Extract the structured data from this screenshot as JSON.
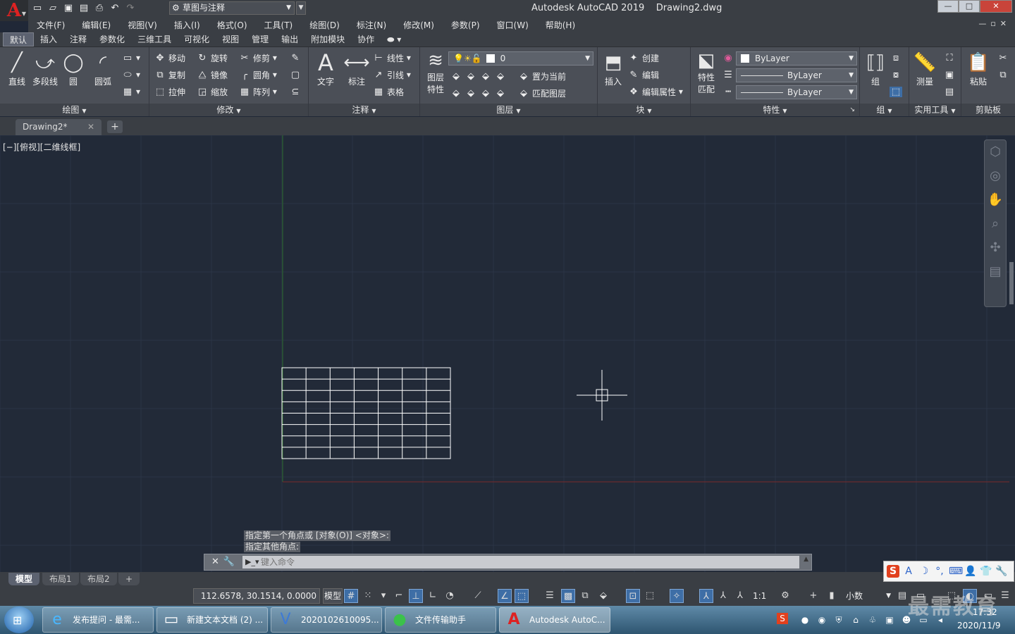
{
  "window": {
    "app_title": "Autodesk AutoCAD 2019",
    "doc_title": "Drawing2.dwg",
    "workspace": "草图与注释",
    "minimize": "—",
    "maximize": "□",
    "close": "✕"
  },
  "menu": [
    "文件(F)",
    "编辑(E)",
    "视图(V)",
    "插入(I)",
    "格式(O)",
    "工具(T)",
    "绘图(D)",
    "标注(N)",
    "修改(M)",
    "参数(P)",
    "窗口(W)",
    "帮助(H)"
  ],
  "ribbon_tabs": [
    "默认",
    "插入",
    "注释",
    "参数化",
    "三维工具",
    "可视化",
    "视图",
    "管理",
    "输出",
    "附加模块",
    "协作"
  ],
  "ribbon": {
    "draw": {
      "title": "绘图",
      "line": "直线",
      "polyline": "多段线",
      "circle": "圆",
      "arc": "圆弧"
    },
    "modify": {
      "title": "修改",
      "move": "移动",
      "rotate": "旋转",
      "trim": "修剪",
      "copy": "复制",
      "mirror": "镜像",
      "fillet": "圆角",
      "stretch": "拉伸",
      "scale": "缩放",
      "array": "阵列"
    },
    "annotation": {
      "title": "注释",
      "text": "文字",
      "dimension": "标注",
      "linear": "线性",
      "leader": "引线",
      "table": "表格"
    },
    "layers": {
      "title": "图层",
      "layer_props_1": "图层",
      "layer_props_2": "特性",
      "layer_value": "0",
      "set_current": "置为当前",
      "match_layer": "匹配图层"
    },
    "block": {
      "title": "块",
      "insert": "插入",
      "create": "创建",
      "edit": "编辑",
      "edit_attr": "编辑属性"
    },
    "properties": {
      "title": "特性",
      "match_1": "特性",
      "match_2": "匹配",
      "color": "ByLayer",
      "linetype": "ByLayer",
      "lineweight": "ByLayer"
    },
    "groups": {
      "title": "组",
      "group": "组"
    },
    "utilities": {
      "title": "实用工具",
      "measure": "测量"
    },
    "clipboard": {
      "title": "剪贴板",
      "paste": "粘贴"
    }
  },
  "file_tab": {
    "name": "Drawing2*",
    "close": "✕",
    "new": "+"
  },
  "viewport_label": "[−][俯视][二维线框]",
  "command": {
    "history_1": "指定第一个角点或 [对象(O)] <对象>:",
    "history_2": "指定其他角点:",
    "placeholder": "键入命令"
  },
  "layout_tabs": [
    "模型",
    "布局1",
    "布局2"
  ],
  "status": {
    "coords": "112.6578, 30.1514, 0.0000",
    "model": "模型",
    "scale": "1:1",
    "units": "小数"
  },
  "taskbar": {
    "tasks": [
      "发布提问 - 最需...",
      "新建文本文档 (2) ...",
      "2020102610095...",
      "文件传输助手",
      "Autodesk AutoC..."
    ],
    "time": "17:32",
    "date": "2020/11/9"
  },
  "watermark": "最需教育",
  "drawing": {
    "table_rows": 8,
    "table_cols": 7,
    "grid_color": "#2b3446",
    "axis_x_color": "#7a2a2a",
    "axis_y_color": "#2a6a2a"
  }
}
